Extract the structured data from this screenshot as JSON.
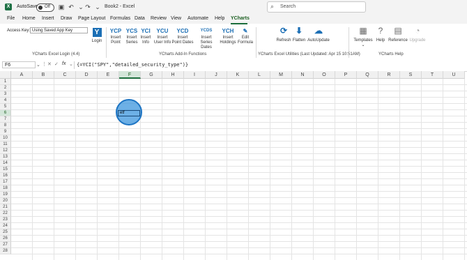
{
  "titlebar": {
    "autosave_label": "AutoSave",
    "autosave_state": "Off",
    "doc_title": "Book2 - Excel",
    "search_placeholder": "Search"
  },
  "tabs": [
    "File",
    "Home",
    "Insert",
    "Draw",
    "Page Layout",
    "Formulas",
    "Data",
    "Review",
    "View",
    "Automate",
    "Help",
    "YCharts"
  ],
  "active_tab": "YCharts",
  "ribbon": {
    "login": {
      "access_key_label": "Access Key:",
      "access_key_value": "Using Saved App Key",
      "login_icon": "Y",
      "login_label": "Login",
      "group_label": "YCharts Excel Login (4.4)"
    },
    "addin": {
      "buttons": [
        {
          "glyph": "YCP",
          "label1": "Insert",
          "label2": "Point"
        },
        {
          "glyph": "YCS",
          "label1": "Insert",
          "label2": "Series"
        },
        {
          "glyph": "YCI",
          "label1": "Insert",
          "label2": "Info"
        },
        {
          "glyph": "YCU",
          "label1": "Insert",
          "label2": "User Info"
        },
        {
          "glyph": "YCD",
          "label1": "Insert",
          "label2": "Point Dates"
        },
        {
          "glyph": "YCDS",
          "label1": "Insert",
          "label2": "Series Dates"
        },
        {
          "glyph": "YCH",
          "label1": "Insert",
          "label2": "Holdings"
        },
        {
          "glyph": "✎",
          "label1": "Edit",
          "label2": "Formula"
        }
      ],
      "group_label": "YCharts Add-In Functions"
    },
    "utilities": {
      "buttons": [
        {
          "glyph": "⟳",
          "label": "Refresh"
        },
        {
          "glyph": "⬇",
          "label": "Flatten"
        },
        {
          "glyph": "☁",
          "label": "AutoUpdate"
        }
      ],
      "group_label": "YCharts Excel Utilities (Last Updated: Apr 15 10:51AM)"
    },
    "help": {
      "buttons": [
        {
          "glyph": "▦",
          "label": "Templates"
        },
        {
          "glyph": "?",
          "label": "Help"
        },
        {
          "glyph": "▤",
          "label": "Reference"
        },
        {
          "glyph": "◔",
          "label": "Upgrade"
        }
      ],
      "group_label": "YCharts Help"
    }
  },
  "formula_bar": {
    "name_box": "F6",
    "formula": "{=YCI(\"SPY\",\"detailed_security_type\")}"
  },
  "grid": {
    "columns": [
      "A",
      "B",
      "C",
      "D",
      "E",
      "F",
      "G",
      "H",
      "I",
      "J",
      "K",
      "L",
      "M",
      "N",
      "O",
      "P",
      "Q",
      "R",
      "S",
      "T",
      "U"
    ],
    "rows": [
      "1",
      "2",
      "3",
      "4",
      "5",
      "6",
      "7",
      "8",
      "9",
      "10",
      "11",
      "12",
      "13",
      "14",
      "15",
      "16",
      "17",
      "18",
      "19",
      "20",
      "21",
      "22",
      "23",
      "24",
      "25",
      "26",
      "27",
      "28"
    ],
    "selected_column": "F",
    "selected_row": "6",
    "active_cell_value": "etf"
  },
  "colors": {
    "excel_green": "#1b6e3c",
    "ycharts_blue": "#1c6fb5",
    "highlight": "#3491dc"
  }
}
